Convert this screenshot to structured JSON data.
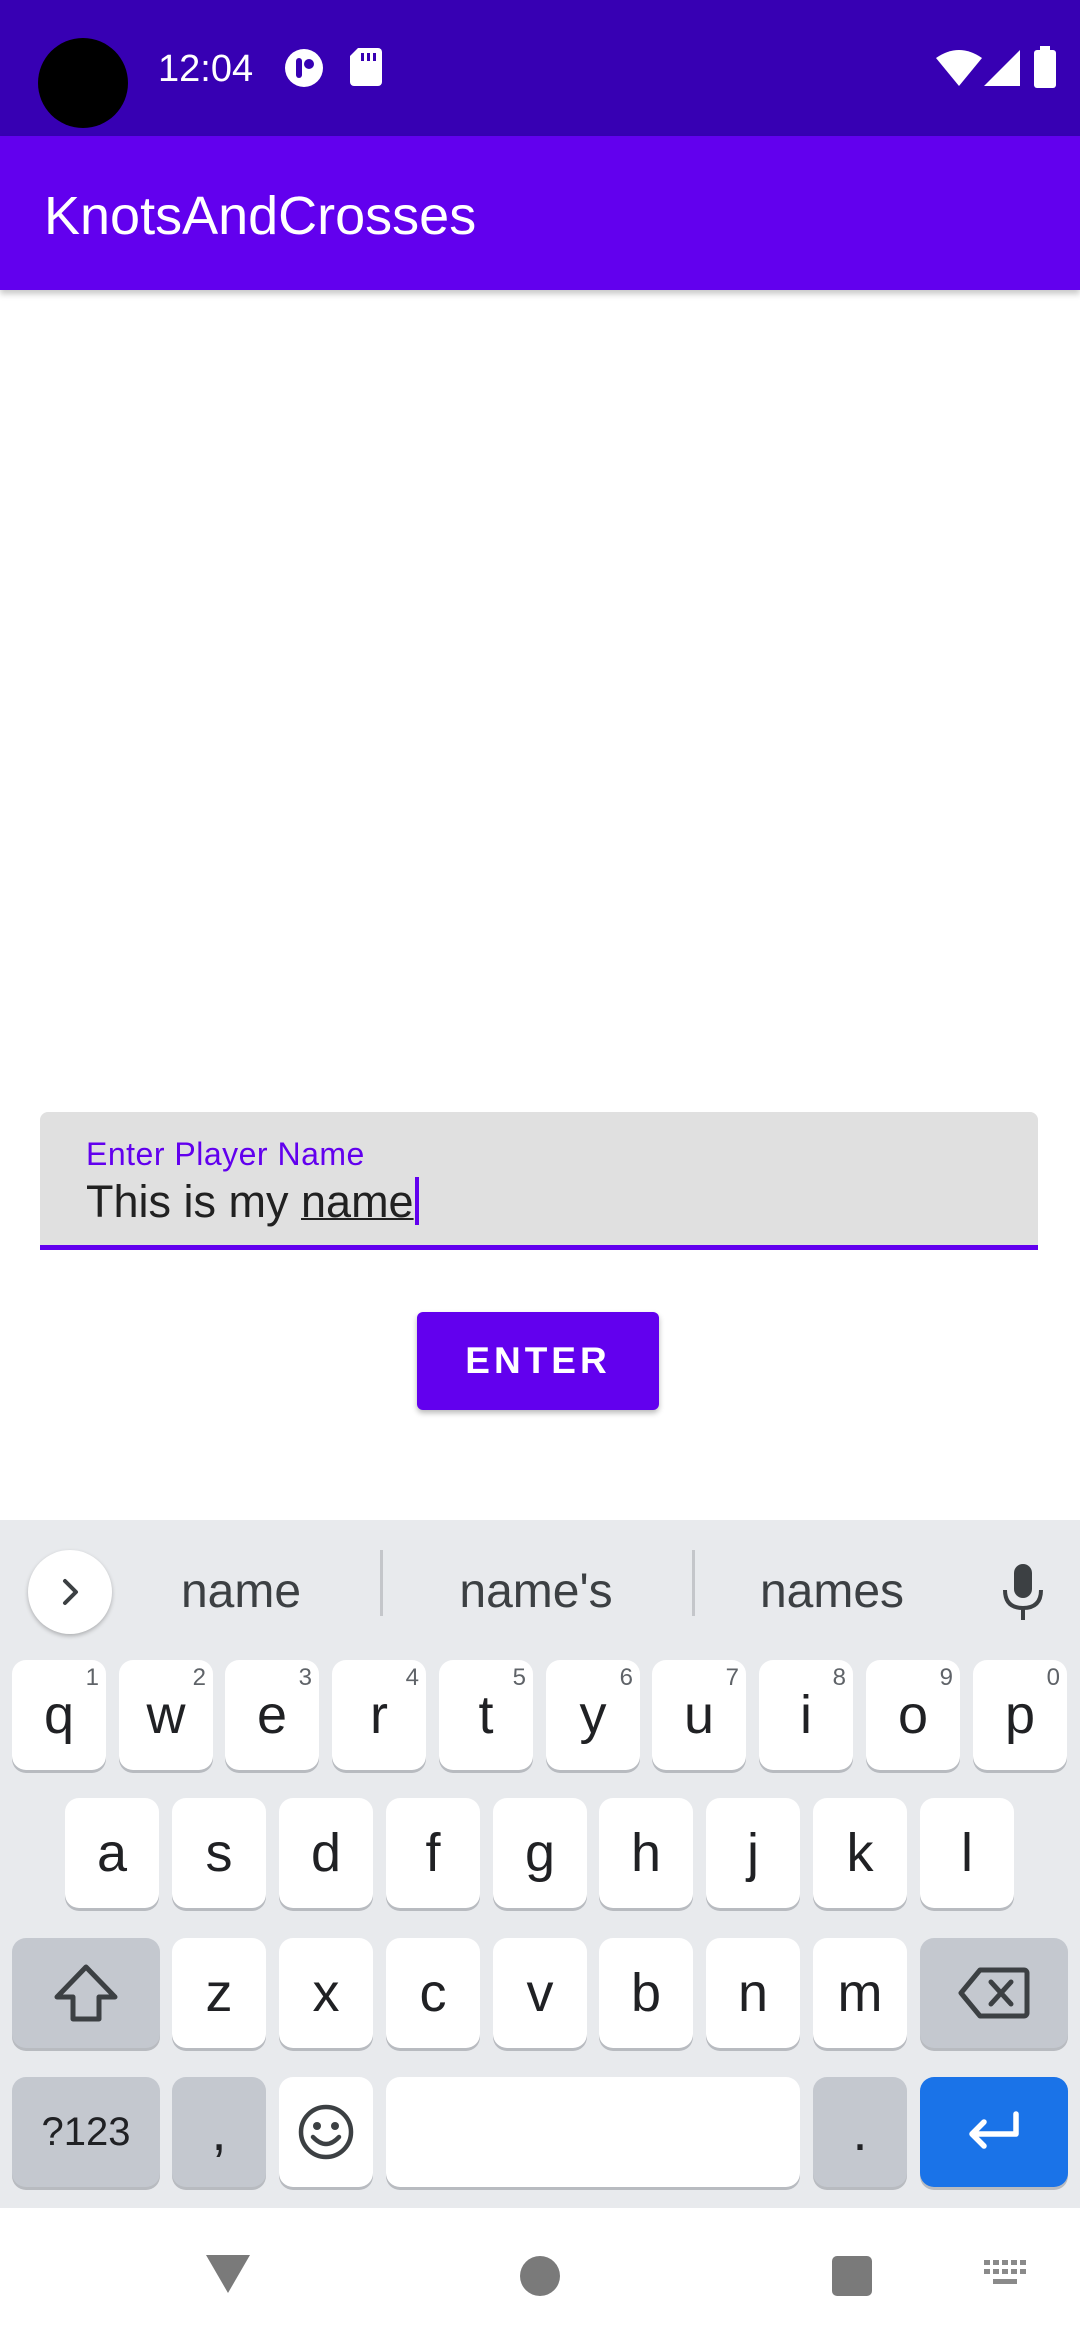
{
  "status_bar": {
    "time": "12:04",
    "left_icons": [
      "assistant-icon",
      "sd-card-icon"
    ],
    "right_icons": [
      "wifi-icon",
      "cell-signal-icon",
      "battery-icon"
    ]
  },
  "app_bar": {
    "title": "KnotsAndCrosses"
  },
  "name_field": {
    "label": "Enter Player Name",
    "value_plain": "This is my ",
    "value_composing": "name"
  },
  "enter_button": {
    "label": "ENTER"
  },
  "keyboard": {
    "suggestions": [
      "name",
      "name's",
      "names"
    ],
    "row1": [
      {
        "label": "q",
        "hint": "1"
      },
      {
        "label": "w",
        "hint": "2"
      },
      {
        "label": "e",
        "hint": "3"
      },
      {
        "label": "r",
        "hint": "4"
      },
      {
        "label": "t",
        "hint": "5"
      },
      {
        "label": "y",
        "hint": "6"
      },
      {
        "label": "u",
        "hint": "7"
      },
      {
        "label": "i",
        "hint": "8"
      },
      {
        "label": "o",
        "hint": "9"
      },
      {
        "label": "p",
        "hint": "0"
      }
    ],
    "row2": [
      "a",
      "s",
      "d",
      "f",
      "g",
      "h",
      "j",
      "k",
      "l"
    ],
    "row3": [
      "z",
      "x",
      "c",
      "v",
      "b",
      "n",
      "m"
    ],
    "symbols_label": "?123",
    "comma_label": ",",
    "period_label": ".",
    "accent_color": "#1a73e8"
  },
  "colors": {
    "primary": "#6200ee",
    "primary_dark": "#3700b3",
    "field_background": "#e0e0e0"
  }
}
